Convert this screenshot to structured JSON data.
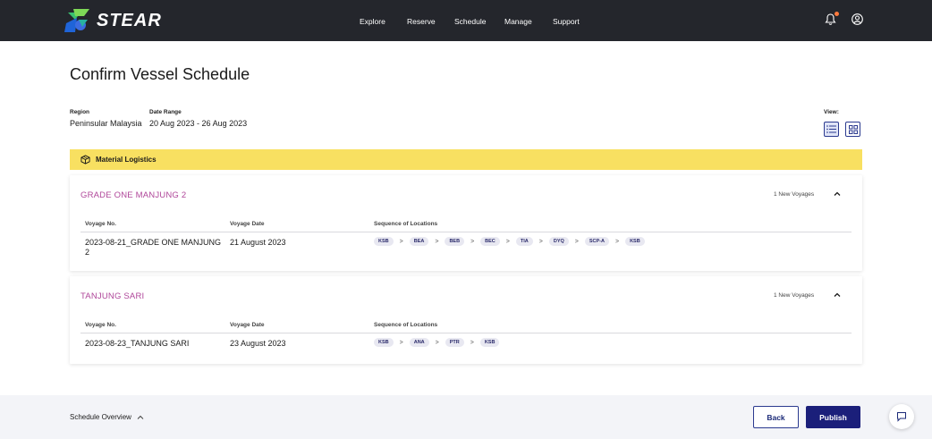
{
  "app": {
    "brand": "STEAR"
  },
  "nav": {
    "items": [
      {
        "label": "Explore"
      },
      {
        "label": "Reserve"
      },
      {
        "label": "Schedule"
      },
      {
        "label": "Manage"
      },
      {
        "label": "Support"
      }
    ]
  },
  "page": {
    "title": "Confirm Vessel Schedule"
  },
  "filters": {
    "region_label": "Region",
    "region_value": "Peninsular Malaysia",
    "date_label": "Date Range",
    "date_value": "20 Aug 2023 - 26 Aug 2023",
    "view_label": "View:"
  },
  "category": {
    "label": "Material Logistics",
    "icon": "package-icon"
  },
  "table_headers": {
    "voyage_no": "Voyage No.",
    "voyage_date": "Voyage Date",
    "sequence": "Sequence of Locations"
  },
  "vessels": [
    {
      "name": "GRADE ONE MANJUNG 2",
      "voyage_count": "1 New Voyages",
      "voyage_no": "2023-08-21_GRADE ONE MANJUNG 2",
      "voyage_date": "21 August 2023",
      "locations": [
        "KSB",
        "BEA",
        "BEB",
        "BEC",
        "TIA",
        "DYQ",
        "SCP-A",
        "KSB"
      ]
    },
    {
      "name": "TANJUNG SARI",
      "voyage_count": "1 New Voyages",
      "voyage_no": "2023-08-23_TANJUNG SARI",
      "voyage_date": "23 August 2023",
      "locations": [
        "KSB",
        "ANA",
        "PTR",
        "KSB"
      ]
    }
  ],
  "footer": {
    "overview_label": "Schedule Overview",
    "back_label": "Back",
    "publish_label": "Publish"
  },
  "colors": {
    "topbar": "#24262c",
    "accent": "#1b1f7a",
    "vessel_name": "#b0479a",
    "category_bg": "#f8e061"
  }
}
